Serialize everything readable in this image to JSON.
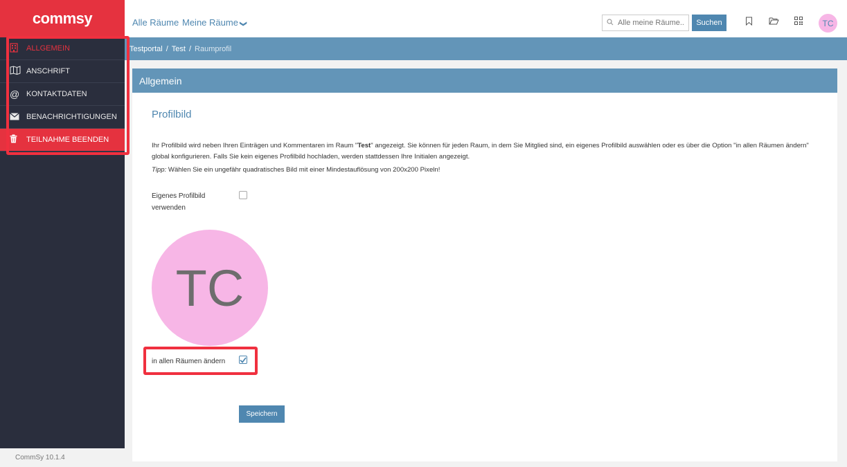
{
  "header": {
    "logo_text": "commsy",
    "nav": {
      "all_rooms": "Alle Räume",
      "my_rooms": "Meine Räume",
      "chevron": "❯"
    },
    "search": {
      "placeholder": "Alle meine Räume...",
      "button": "Suchen"
    },
    "icons": [
      "bookmark-icon",
      "folder-icon",
      "qr-code-icon"
    ],
    "avatar_initials": "TC"
  },
  "breadcrumb": {
    "portal": "Testportal",
    "room": "Test",
    "current": "Raumprofil",
    "separator": "/"
  },
  "sidebar": {
    "items": [
      {
        "label": "ALLGEMEIN",
        "icon": "building-icon",
        "state": "active"
      },
      {
        "label": "ANSCHRIFT",
        "icon": "map-icon",
        "state": "normal"
      },
      {
        "label": "KONTAKTDATEN",
        "icon": "at-icon",
        "state": "normal"
      },
      {
        "label": "BENACHRICHTIGUNGEN",
        "icon": "envelope-icon",
        "state": "normal"
      },
      {
        "label": "TEILNAHME BEENDEN",
        "icon": "trash-icon",
        "state": "danger"
      }
    ],
    "version": "CommSy 10.1.4"
  },
  "panel": {
    "header": "Allgemein",
    "section_title": "Profilbild",
    "description": {
      "part1": "Ihr Profilbild wird neben Ihren Einträgen und Kommentaren im Raum \"",
      "room": "Test",
      "part2": "\" angezeigt. Sie können für jeden Raum, in dem Sie Mitglied sind, ein eigenes Profilbild auswählen oder es über die Option \"in allen Räumen ändern\" global konfigurieren. Falls Sie kein eigenes Profilbild hochladen, werden stattdessen Ihre Initialen angezeigt."
    },
    "tip": {
      "label": "Tipp:",
      "text": " Wählen Sie ein ungefähr quadratisches Bild mit einer Mindestauflösung von 200x200 Pixeln!"
    },
    "own_picture": {
      "label": "Eigenes Profilbild verwenden",
      "checked": false
    },
    "profile_initials": "TC",
    "change_all": {
      "label": "in allen Räumen ändern",
      "checked": true
    },
    "save_button": "Speichern"
  },
  "colors": {
    "brand_red": "#e5323f",
    "accent_blue": "#4f87b0",
    "sidebar_bg": "#2a2e3d",
    "avatar_pink": "#f7b6e6",
    "highlight_red": "#f0303f"
  }
}
